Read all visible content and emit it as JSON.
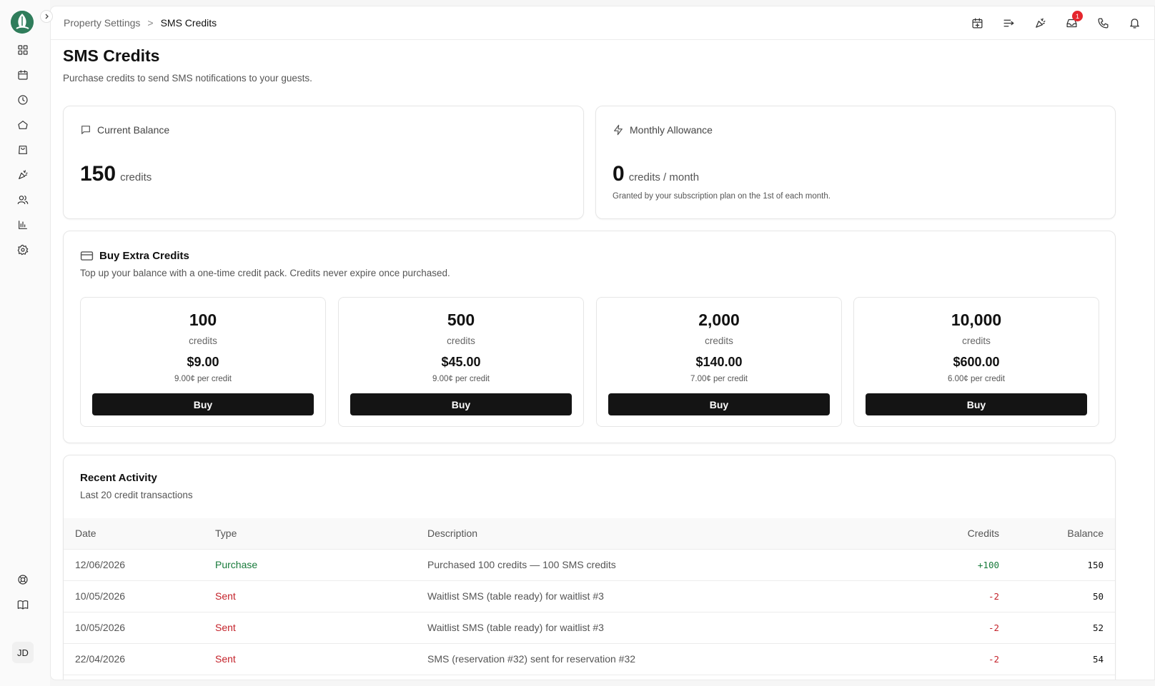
{
  "breadcrumb": {
    "parent": "Property Settings",
    "separator": ">",
    "current": "SMS Credits"
  },
  "header": {
    "notification_count": "1"
  },
  "user": {
    "initials": "JD"
  },
  "page": {
    "title": "SMS Credits",
    "subtitle": "Purchase credits to send SMS notifications to your guests."
  },
  "balance": {
    "label": "Current Balance",
    "value": "150",
    "unit": "credits"
  },
  "allowance": {
    "label": "Monthly Allowance",
    "value": "0",
    "unit": "credits / month",
    "note": "Granted by your subscription plan on the 1st of each month."
  },
  "buy": {
    "title": "Buy Extra Credits",
    "subtitle": "Top up your balance with a one-time credit pack. Credits never expire once purchased.",
    "packs": [
      {
        "credits": "100",
        "label": "credits",
        "price": "$9.00",
        "per": "9.00¢ per credit",
        "button": "Buy"
      },
      {
        "credits": "500",
        "label": "credits",
        "price": "$45.00",
        "per": "9.00¢ per credit",
        "button": "Buy"
      },
      {
        "credits": "2,000",
        "label": "credits",
        "price": "$140.00",
        "per": "7.00¢ per credit",
        "button": "Buy"
      },
      {
        "credits": "10,000",
        "label": "credits",
        "price": "$600.00",
        "per": "6.00¢ per credit",
        "button": "Buy"
      }
    ]
  },
  "activity": {
    "title": "Recent Activity",
    "subtitle": "Last 20 credit transactions",
    "columns": [
      "Date",
      "Type",
      "Description",
      "Credits",
      "Balance"
    ],
    "rows": [
      {
        "date": "12/06/2026",
        "type": "Purchase",
        "description": "Purchased 100 credits — 100 SMS credits",
        "credits": "+100",
        "balance": "150"
      },
      {
        "date": "10/05/2026",
        "type": "Sent",
        "description": "Waitlist SMS (table ready) for waitlist #3",
        "credits": "-2",
        "balance": "50"
      },
      {
        "date": "10/05/2026",
        "type": "Sent",
        "description": "Waitlist SMS (table ready) for waitlist #3",
        "credits": "-2",
        "balance": "52"
      },
      {
        "date": "22/04/2026",
        "type": "Sent",
        "description": "SMS (reservation #32) sent for reservation #32",
        "credits": "-2",
        "balance": "54"
      }
    ]
  },
  "colors": {
    "purchase": "#177a3a",
    "sent": "#c4222a",
    "button": "#141414",
    "badge": "#e5262d"
  }
}
